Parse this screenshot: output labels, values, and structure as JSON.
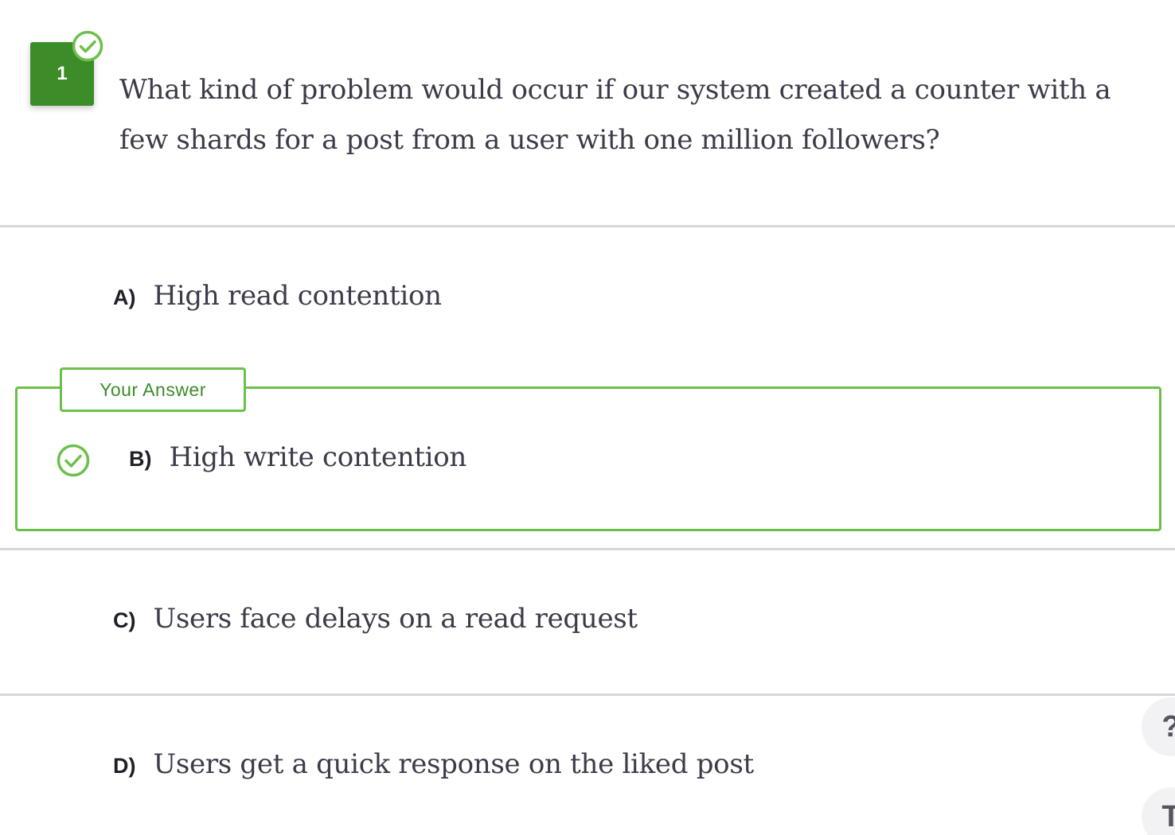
{
  "question": {
    "number": "1",
    "text": "What kind of problem would occur if our system created a counter with a few shards for a post from a user with one million followers?",
    "status_icon": "check-circle-icon"
  },
  "options": [
    {
      "letter": "A)",
      "text": "High read contention"
    },
    {
      "letter": "B)",
      "text": "High write contention",
      "selected": true,
      "correct": true
    },
    {
      "letter": "C)",
      "text": "Users face delays on a read request"
    },
    {
      "letter": "D)",
      "text": "Users get a quick response on the liked post"
    }
  ],
  "answer_tag": "Your Answer",
  "floating_buttons": [
    {
      "icon": "help-icon",
      "glyph": "?"
    },
    {
      "icon": "text-icon",
      "glyph": "T"
    }
  ],
  "colors": {
    "badge_green": "#3c8c2a",
    "accent_green": "#6cc04a",
    "divider_gray": "#d6d6db",
    "text_dark": "#3b3b4a"
  }
}
